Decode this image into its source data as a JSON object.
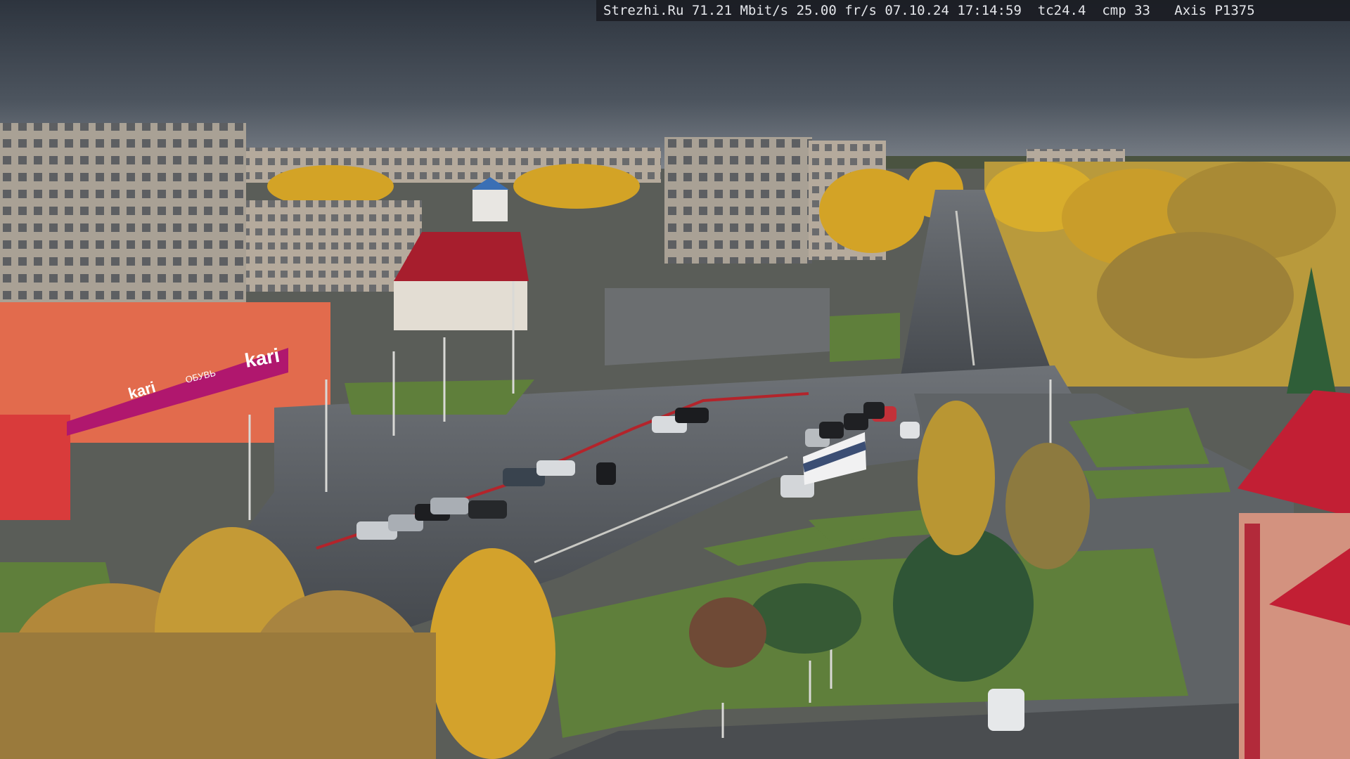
{
  "overlay": {
    "site": "Strezhi.Ru",
    "bitrate": "71.21 Mbit/s",
    "framerate": "25.00 fr/s",
    "date": "07.10.24",
    "time": "17:14:59",
    "tc": "tc24.4",
    "cmp": "cmp 33",
    "camera": "Axis P1375"
  },
  "signs": {
    "store_big": "kari",
    "store_small": "kari",
    "store_slogan": "ОБУВЬ"
  },
  "colors": {
    "sky_top": "#2f3640",
    "sky_horizon": "#7a8088",
    "autumn_yellow": "#d9ac2a",
    "asphalt": "#4e5257",
    "kari_magenta": "#b0176e",
    "roof_red": "#b51d2c"
  }
}
